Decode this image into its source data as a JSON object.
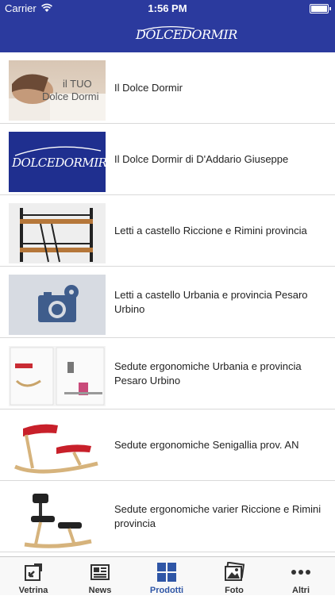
{
  "status": {
    "carrier": "Carrier",
    "time": "1:56 PM"
  },
  "header": {
    "logo_text": "DOLCEDORMIR"
  },
  "thumbs": {
    "t1_line1": "il TUO",
    "t1_line2": "Dolce Dormi",
    "t2_logo": "DOLCEDORMIR"
  },
  "items": [
    {
      "title": "Il Dolce Dormir",
      "icon": "sleeping-woman-photo"
    },
    {
      "title": "Il Dolce Dormir di D'Addario Giuseppe",
      "icon": "dolcedormir-logo-thumb"
    },
    {
      "title": "Letti a castello Riccione e Rimini provincia",
      "icon": "bunk-bed-photo"
    },
    {
      "title": "Letti a castello Urbania e provincia Pesaro Urbino",
      "icon": "camera-placeholder-icon"
    },
    {
      "title": "Sedute ergonomiche Urbania  e provincia Pesaro Urbino",
      "icon": "ergonomic-chairs-collage"
    },
    {
      "title": "Sedute ergonomiche Senigallia prov. AN",
      "icon": "kneeling-chair-photo"
    },
    {
      "title": "Sedute ergonomiche varier Riccione e Rimini provincia",
      "icon": "varier-chair-photo"
    }
  ],
  "tabs": [
    {
      "label": "Vetrina",
      "icon": "vetrina-icon",
      "active": false
    },
    {
      "label": "News",
      "icon": "news-icon",
      "active": false
    },
    {
      "label": "Prodotti",
      "icon": "grid-icon",
      "active": true
    },
    {
      "label": "Foto",
      "icon": "photos-icon",
      "active": false
    },
    {
      "label": "Altri",
      "icon": "more-icon",
      "active": false
    }
  ],
  "colors": {
    "navbar": "#2b3a9e",
    "active_tab": "#2f56a6",
    "tab_icon": "#333333"
  }
}
